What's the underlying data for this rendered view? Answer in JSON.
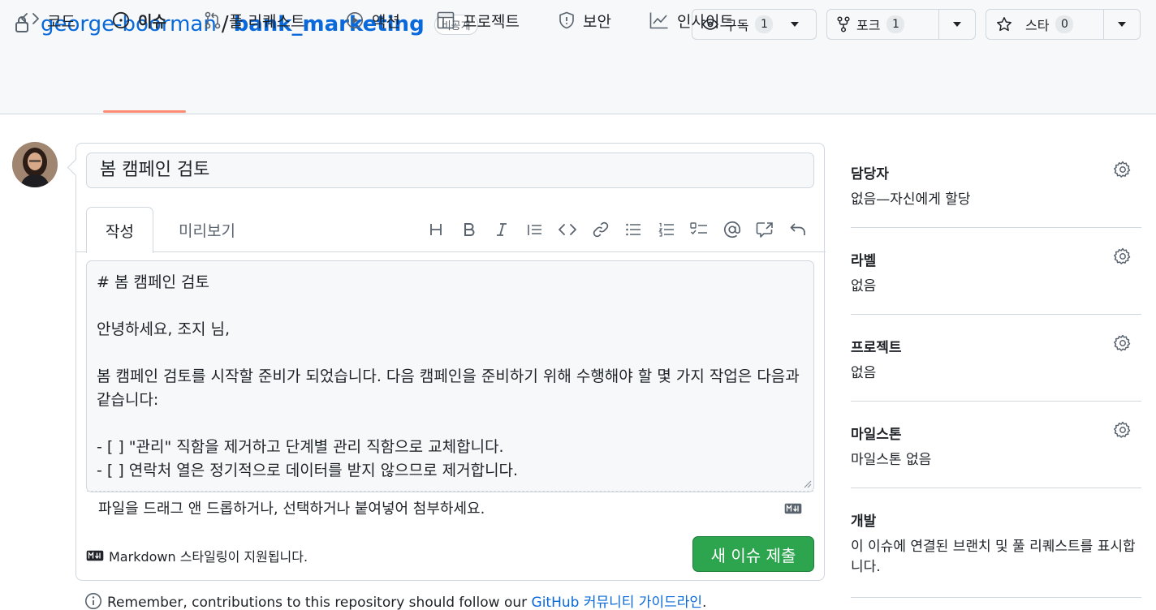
{
  "repo": {
    "owner": "george-boorman",
    "separator": "/",
    "name": "bank_marketing",
    "visibility": "비공개"
  },
  "actions": {
    "watch": {
      "label": "구독",
      "count": "1"
    },
    "fork": {
      "label": "포크",
      "count": "1"
    },
    "star": {
      "label": "스타",
      "count": "0"
    }
  },
  "tabs": [
    {
      "label": "코드",
      "icon": "code-icon"
    },
    {
      "label": "이슈",
      "icon": "issue-icon",
      "active": true
    },
    {
      "label": "풀 리퀘스트",
      "icon": "pull-request-icon"
    },
    {
      "label": "액션",
      "icon": "play-icon"
    },
    {
      "label": "프로젝트",
      "icon": "table-icon"
    },
    {
      "label": "보안",
      "icon": "shield-icon"
    },
    {
      "label": "인사이트",
      "icon": "graph-icon"
    }
  ],
  "issue": {
    "title": "봄 캠페인 검토",
    "editor_tabs": {
      "write": "작성",
      "preview": "미리보기"
    },
    "body": "# 봄 캠페인 검토\n\n안녕하세요, 조지 님,\n\n봄 캠페인 검토를 시작할 준비가 되었습니다. 다음 캠페인을 준비하기 위해 수행해야 할 몇 가지 작업은 다음과 같습니다:\n\n- [ ] \"관리\" 직함을 제거하고 단계별 관리 직함으로 교체합니다.\n- [ ] 연락처 열은 정기적으로 데이터를 받지 않으므로 제거합니다.",
    "attach_hint": "파일을 드래그 앤 드롭하거나, 선택하거나 붙여넣어 첨부하세요.",
    "markdown_note": "Markdown 스타일링이 지원됩니다.",
    "submit_label": "새 이슈 제출"
  },
  "toolbar_icons": [
    "heading-icon",
    "bold-icon",
    "italic-icon",
    "quote-icon",
    "code-icon",
    "link-icon",
    "bulleted-list-icon",
    "numbered-list-icon",
    "task-list-icon",
    "mention-icon",
    "reference-icon",
    "undo-icon"
  ],
  "guideline": {
    "text": "Remember, contributions to this repository should follow our ",
    "link": "GitHub 커뮤니티 가이드라인",
    "end": "."
  },
  "sidebar": {
    "assignees": {
      "title": "담당자",
      "value": "없음—자신에게 할당"
    },
    "labels": {
      "title": "라벨",
      "value": "없음"
    },
    "projects": {
      "title": "프로젝트",
      "value": "없음"
    },
    "milestone": {
      "title": "마일스톤",
      "value": "마일스톤 없음"
    },
    "development": {
      "title": "개발",
      "value": "이 이슈에 연결된 브랜치 및 풀 리퀘스트를 표시합니다."
    }
  },
  "colors": {
    "accent": "#0969da",
    "submit": "#2da44e",
    "tab_underline": "#fd8c73"
  }
}
